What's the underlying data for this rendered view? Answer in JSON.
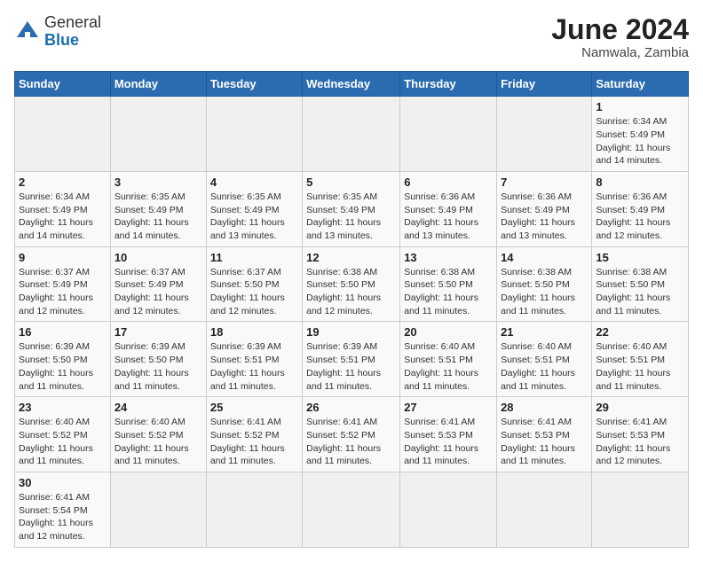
{
  "header": {
    "logo_general": "General",
    "logo_blue": "Blue",
    "month_title": "June 2024",
    "subtitle": "Namwala, Zambia"
  },
  "weekdays": [
    "Sunday",
    "Monday",
    "Tuesday",
    "Wednesday",
    "Thursday",
    "Friday",
    "Saturday"
  ],
  "weeks": [
    [
      {
        "day": "",
        "info": ""
      },
      {
        "day": "",
        "info": ""
      },
      {
        "day": "",
        "info": ""
      },
      {
        "day": "",
        "info": ""
      },
      {
        "day": "",
        "info": ""
      },
      {
        "day": "",
        "info": ""
      },
      {
        "day": "1",
        "info": "Sunrise: 6:34 AM\nSunset: 5:49 PM\nDaylight: 11 hours and 14 minutes."
      }
    ],
    [
      {
        "day": "2",
        "info": "Sunrise: 6:34 AM\nSunset: 5:49 PM\nDaylight: 11 hours and 14 minutes."
      },
      {
        "day": "3",
        "info": "Sunrise: 6:35 AM\nSunset: 5:49 PM\nDaylight: 11 hours and 14 minutes."
      },
      {
        "day": "4",
        "info": "Sunrise: 6:35 AM\nSunset: 5:49 PM\nDaylight: 11 hours and 13 minutes."
      },
      {
        "day": "5",
        "info": "Sunrise: 6:35 AM\nSunset: 5:49 PM\nDaylight: 11 hours and 13 minutes."
      },
      {
        "day": "6",
        "info": "Sunrise: 6:36 AM\nSunset: 5:49 PM\nDaylight: 11 hours and 13 minutes."
      },
      {
        "day": "7",
        "info": "Sunrise: 6:36 AM\nSunset: 5:49 PM\nDaylight: 11 hours and 13 minutes."
      },
      {
        "day": "8",
        "info": "Sunrise: 6:36 AM\nSunset: 5:49 PM\nDaylight: 11 hours and 12 minutes."
      }
    ],
    [
      {
        "day": "9",
        "info": "Sunrise: 6:37 AM\nSunset: 5:49 PM\nDaylight: 11 hours and 12 minutes."
      },
      {
        "day": "10",
        "info": "Sunrise: 6:37 AM\nSunset: 5:49 PM\nDaylight: 11 hours and 12 minutes."
      },
      {
        "day": "11",
        "info": "Sunrise: 6:37 AM\nSunset: 5:50 PM\nDaylight: 11 hours and 12 minutes."
      },
      {
        "day": "12",
        "info": "Sunrise: 6:38 AM\nSunset: 5:50 PM\nDaylight: 11 hours and 12 minutes."
      },
      {
        "day": "13",
        "info": "Sunrise: 6:38 AM\nSunset: 5:50 PM\nDaylight: 11 hours and 11 minutes."
      },
      {
        "day": "14",
        "info": "Sunrise: 6:38 AM\nSunset: 5:50 PM\nDaylight: 11 hours and 11 minutes."
      },
      {
        "day": "15",
        "info": "Sunrise: 6:38 AM\nSunset: 5:50 PM\nDaylight: 11 hours and 11 minutes."
      }
    ],
    [
      {
        "day": "16",
        "info": "Sunrise: 6:39 AM\nSunset: 5:50 PM\nDaylight: 11 hours and 11 minutes."
      },
      {
        "day": "17",
        "info": "Sunrise: 6:39 AM\nSunset: 5:50 PM\nDaylight: 11 hours and 11 minutes."
      },
      {
        "day": "18",
        "info": "Sunrise: 6:39 AM\nSunset: 5:51 PM\nDaylight: 11 hours and 11 minutes."
      },
      {
        "day": "19",
        "info": "Sunrise: 6:39 AM\nSunset: 5:51 PM\nDaylight: 11 hours and 11 minutes."
      },
      {
        "day": "20",
        "info": "Sunrise: 6:40 AM\nSunset: 5:51 PM\nDaylight: 11 hours and 11 minutes."
      },
      {
        "day": "21",
        "info": "Sunrise: 6:40 AM\nSunset: 5:51 PM\nDaylight: 11 hours and 11 minutes."
      },
      {
        "day": "22",
        "info": "Sunrise: 6:40 AM\nSunset: 5:51 PM\nDaylight: 11 hours and 11 minutes."
      }
    ],
    [
      {
        "day": "23",
        "info": "Sunrise: 6:40 AM\nSunset: 5:52 PM\nDaylight: 11 hours and 11 minutes."
      },
      {
        "day": "24",
        "info": "Sunrise: 6:40 AM\nSunset: 5:52 PM\nDaylight: 11 hours and 11 minutes."
      },
      {
        "day": "25",
        "info": "Sunrise: 6:41 AM\nSunset: 5:52 PM\nDaylight: 11 hours and 11 minutes."
      },
      {
        "day": "26",
        "info": "Sunrise: 6:41 AM\nSunset: 5:52 PM\nDaylight: 11 hours and 11 minutes."
      },
      {
        "day": "27",
        "info": "Sunrise: 6:41 AM\nSunset: 5:53 PM\nDaylight: 11 hours and 11 minutes."
      },
      {
        "day": "28",
        "info": "Sunrise: 6:41 AM\nSunset: 5:53 PM\nDaylight: 11 hours and 11 minutes."
      },
      {
        "day": "29",
        "info": "Sunrise: 6:41 AM\nSunset: 5:53 PM\nDaylight: 11 hours and 12 minutes."
      }
    ],
    [
      {
        "day": "30",
        "info": "Sunrise: 6:41 AM\nSunset: 5:54 PM\nDaylight: 11 hours and 12 minutes."
      },
      {
        "day": "",
        "info": ""
      },
      {
        "day": "",
        "info": ""
      },
      {
        "day": "",
        "info": ""
      },
      {
        "day": "",
        "info": ""
      },
      {
        "day": "",
        "info": ""
      },
      {
        "day": "",
        "info": ""
      }
    ]
  ]
}
